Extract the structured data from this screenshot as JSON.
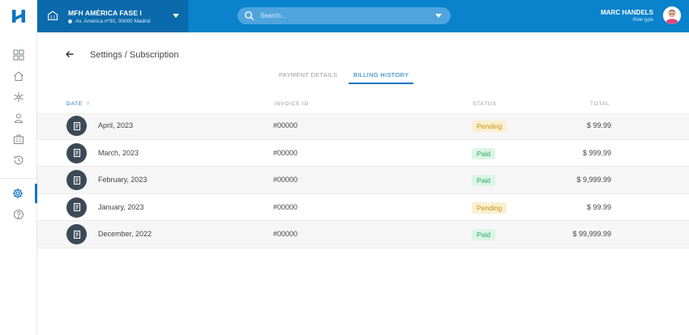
{
  "header": {
    "location_name": "MFH AMÉRICA FASE I",
    "location_address": "Av. América nº30, 00000 Madrid",
    "search_placeholder": "Search...",
    "user_name": "MARC HANDELS",
    "user_role": "Role type"
  },
  "sidebar": {
    "items": [
      {
        "icon": "grid-icon"
      },
      {
        "icon": "home-icon"
      },
      {
        "icon": "network-icon"
      },
      {
        "icon": "user-icon"
      },
      {
        "icon": "building-icon"
      },
      {
        "icon": "history-icon"
      },
      {
        "icon": "gear-icon",
        "active": true
      },
      {
        "icon": "help-icon"
      }
    ]
  },
  "page": {
    "title": "Settings / Subscription"
  },
  "tabs": {
    "payment": "PAYMENT DETAILS",
    "billing": "BILLING HISTORY",
    "active": "billing"
  },
  "table": {
    "headers": {
      "date": "DATE",
      "invoice": "INVOICE ID",
      "status": "STATUS",
      "total": "TOTAL"
    },
    "rows": [
      {
        "date": "April, 2023",
        "invoice": "#00000",
        "status": "Pending",
        "total": "$ 99.99"
      },
      {
        "date": "March, 2023",
        "invoice": "#00000",
        "status": "Paid",
        "total": "$ 999.99"
      },
      {
        "date": "February, 2023",
        "invoice": "#00000",
        "status": "Paid",
        "total": "$ 9,999.99"
      },
      {
        "date": "January, 2023",
        "invoice": "#00000",
        "status": "Pending",
        "total": "$ 99.99"
      },
      {
        "date": "December, 2022",
        "invoice": "#00000",
        "status": "Paid",
        "total": "$ 99,999.99"
      }
    ]
  },
  "colors": {
    "header_blue": "#0a82cc",
    "location_blue": "#0a6aab",
    "accent": "#0f76c2",
    "pending_bg": "#fbefce",
    "pending_text": "#c39218",
    "paid_bg": "#dcf5e6",
    "paid_text": "#2aa866"
  }
}
